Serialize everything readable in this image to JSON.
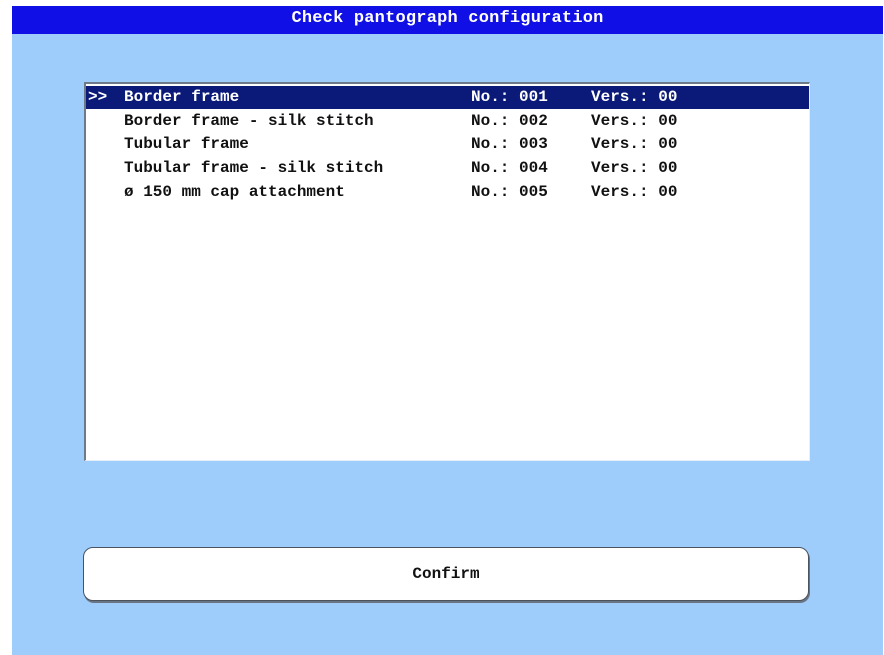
{
  "title": "Check pantograph configuration",
  "list": {
    "rows": [
      {
        "marker": ">>",
        "name": "Border frame",
        "no": "No.: 001",
        "vers": "Vers.: 00",
        "selected": true
      },
      {
        "marker": "",
        "name": "Border frame - silk stitch",
        "no": "No.: 002",
        "vers": "Vers.: 00",
        "selected": false
      },
      {
        "marker": "",
        "name": "Tubular frame",
        "no": "No.: 003",
        "vers": "Vers.: 00",
        "selected": false
      },
      {
        "marker": "",
        "name": "Tubular frame - silk stitch",
        "no": "No.: 004",
        "vers": "Vers.: 00",
        "selected": false
      },
      {
        "marker": "",
        "name": "ø 150 mm cap attachment",
        "no": "No.: 005",
        "vers": "Vers.: 00",
        "selected": false
      }
    ]
  },
  "confirm_label": "Confirm",
  "colors": {
    "background": "#9fcdfb",
    "title_bar": "#1010e6",
    "selection": "#0b1a78"
  }
}
